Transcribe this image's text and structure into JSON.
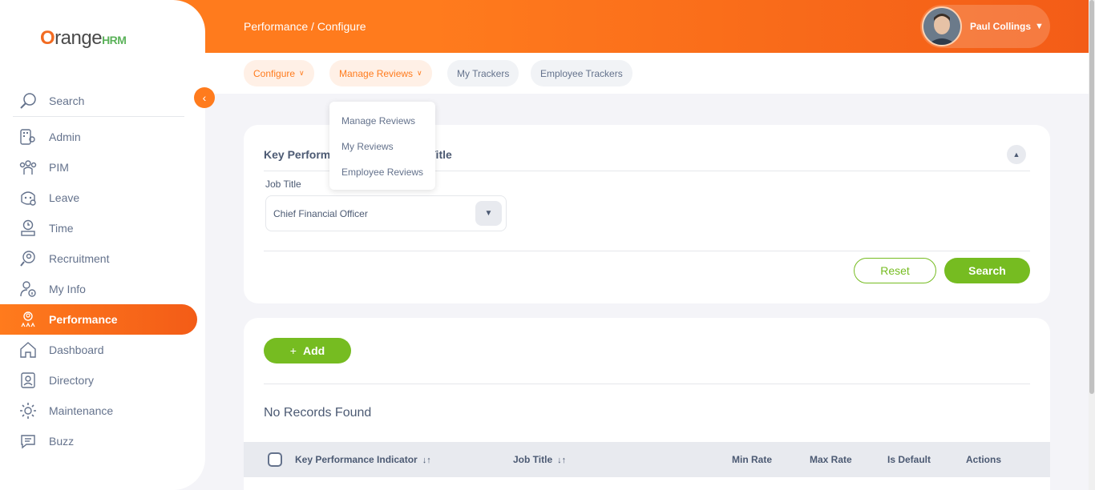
{
  "app": {
    "logo_prefix": "O",
    "logo_word": "range",
    "logo_suffix": "HRM"
  },
  "header": {
    "breadcrumb": "Performance / Configure",
    "user_name": "Paul Collings"
  },
  "top_nav": {
    "tabs": [
      {
        "label": "Configure",
        "has_chevron": true
      },
      {
        "label": "Manage Reviews",
        "has_chevron": true
      },
      {
        "label": "My Trackers"
      },
      {
        "label": "Employee Trackers"
      }
    ]
  },
  "dropdown": {
    "items": [
      "Manage Reviews",
      "My Reviews",
      "Employee Reviews"
    ]
  },
  "sidebar": {
    "search_label": "Search",
    "items": [
      {
        "label": "Admin",
        "icon": "admin-icon"
      },
      {
        "label": "PIM",
        "icon": "pim-icon"
      },
      {
        "label": "Leave",
        "icon": "leave-icon"
      },
      {
        "label": "Time",
        "icon": "time-icon"
      },
      {
        "label": "Recruitment",
        "icon": "recruitment-icon"
      },
      {
        "label": "My Info",
        "icon": "my-info-icon"
      },
      {
        "label": "Performance",
        "icon": "performance-icon",
        "active": true
      },
      {
        "label": "Dashboard",
        "icon": "dashboard-icon"
      },
      {
        "label": "Directory",
        "icon": "directory-icon"
      },
      {
        "label": "Maintenance",
        "icon": "maintenance-icon"
      },
      {
        "label": "Buzz",
        "icon": "buzz-icon"
      }
    ]
  },
  "filter": {
    "title_visible_left": "Key Perform",
    "title_visible_right": "ob Title",
    "job_title_label": "Job Title",
    "job_title_value": "Chief Financial Officer",
    "reset_label": "Reset",
    "search_label": "Search"
  },
  "list": {
    "add_label": "Add",
    "no_records": "No Records Found",
    "columns": [
      "Key Performance Indicator",
      "Job Title",
      "Min Rate",
      "Max Rate",
      "Is Default",
      "Actions"
    ]
  },
  "colors": {
    "brand_orange": "#ff7b1d",
    "brand_green": "#76bc21"
  }
}
